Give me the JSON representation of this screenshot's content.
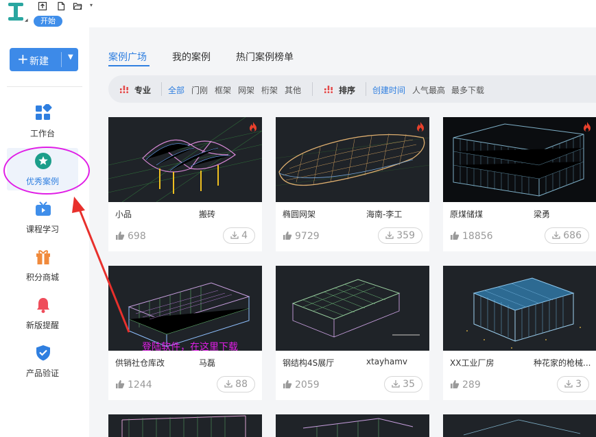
{
  "titlebar": {
    "start_tab": "开始"
  },
  "sidebar": {
    "new_button": "新建",
    "items": [
      {
        "label": "工作台",
        "icon": "dashboard-icon"
      },
      {
        "label": "优秀案例",
        "icon": "star-badge-icon",
        "active": true
      },
      {
        "label": "课程学习",
        "icon": "tv-icon"
      },
      {
        "label": "积分商城",
        "icon": "gift-icon"
      },
      {
        "label": "新版提醒",
        "icon": "bell-icon"
      },
      {
        "label": "产品验证",
        "icon": "shield-check-icon"
      }
    ]
  },
  "tabs": [
    {
      "label": "案例广场",
      "active": true
    },
    {
      "label": "我的案例"
    },
    {
      "label": "热门案例榜单"
    }
  ],
  "filter": {
    "specialty_title": "专业",
    "specialty_options": [
      "全部",
      "门刚",
      "框架",
      "网架",
      "桁架",
      "其他"
    ],
    "sort_title": "排序",
    "sort_options": [
      "创建时间",
      "人气最高",
      "最多下载"
    ]
  },
  "cards": [
    {
      "name": "小品",
      "author": "搬砖",
      "likes": "698",
      "downloads": "4",
      "hot": true
    },
    {
      "name": "椭圆网架",
      "author": "海南-李工",
      "likes": "9729",
      "downloads": "359",
      "hot": true
    },
    {
      "name": "原煤储煤",
      "author": "梁勇",
      "likes": "18856",
      "downloads": "686",
      "hot": true
    },
    {
      "name": "供销社仓库改",
      "author": "马磊",
      "likes": "1244",
      "downloads": "88",
      "hot": false
    },
    {
      "name": "钢结构4S展厅",
      "author": "xtayhamv",
      "likes": "2059",
      "downloads": "35",
      "hot": false
    },
    {
      "name": "XX工业厂房",
      "author": "种花家的枪械...",
      "likes": "289",
      "downloads": "3",
      "hot": false
    }
  ],
  "annotation": {
    "text": "登陆软件，在这里下载",
    "color": "#e01ee6"
  },
  "colors": {
    "accent": "#2f7fe0",
    "annotation": "#e01ee6",
    "thumb_bg": "#1f2328"
  }
}
